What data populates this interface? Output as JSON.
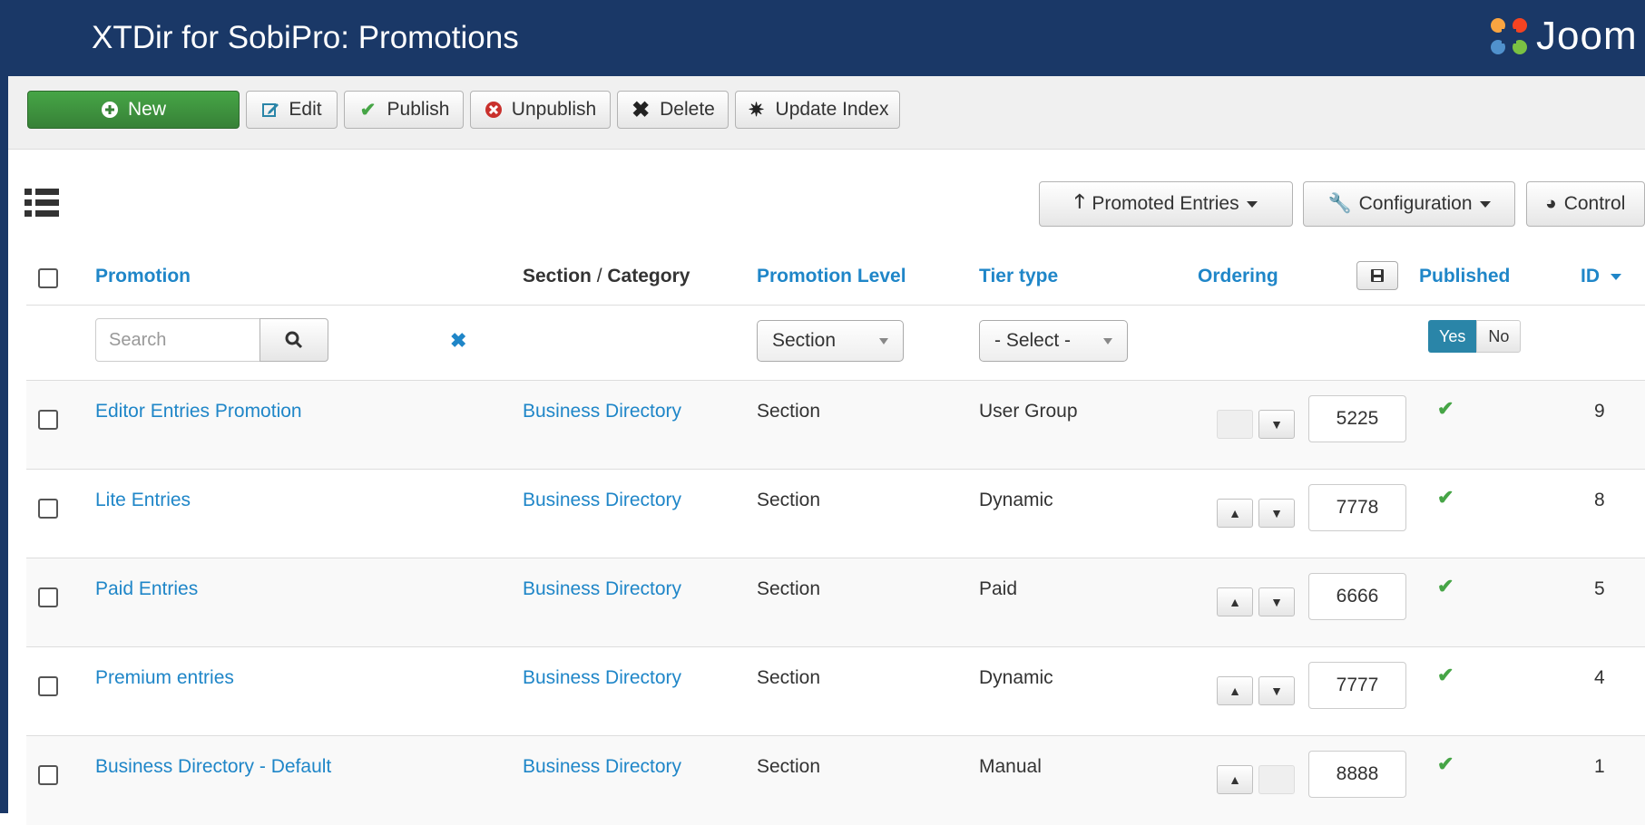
{
  "header": {
    "title": "XTDir for SobiPro: Promotions",
    "brand": "Joom"
  },
  "toolbar": {
    "new_label": "New",
    "edit_label": "Edit",
    "publish_label": "Publish",
    "unpublish_label": "Unpublish",
    "delete_label": "Delete",
    "update_index_label": "Update Index"
  },
  "menus": {
    "promoted_entries": "Promoted Entries",
    "configuration": "Configuration",
    "control": "Control"
  },
  "columns": {
    "promotion": "Promotion",
    "section": "Section",
    "slash": "/",
    "category": "Category",
    "level": "Promotion Level",
    "tier": "Tier type",
    "ordering": "Ordering",
    "published": "Published",
    "id": "ID"
  },
  "filters": {
    "search_placeholder": "Search",
    "level_value": "Section",
    "tier_value": "- Select -",
    "yes": "Yes",
    "no": "No"
  },
  "rows": [
    {
      "promotion": "Editor Entries Promotion",
      "category": "Business Directory",
      "level": "Section",
      "tier": "User Group",
      "ordering": "5225",
      "id": "9"
    },
    {
      "promotion": "Lite Entries",
      "category": "Business Directory",
      "level": "Section",
      "tier": "Dynamic",
      "ordering": "7778",
      "id": "8"
    },
    {
      "promotion": "Paid Entries",
      "category": "Business Directory",
      "level": "Section",
      "tier": "Paid",
      "ordering": "6666",
      "id": "5"
    },
    {
      "promotion": "Premium entries",
      "category": "Business Directory",
      "level": "Section",
      "tier": "Dynamic",
      "ordering": "7777",
      "id": "4"
    },
    {
      "promotion": "Business Directory - Default",
      "category": "Business Directory",
      "level": "Section",
      "tier": "Manual",
      "ordering": "8888",
      "id": "1"
    }
  ],
  "colors": {
    "header_bg": "#1a3867",
    "link": "#1f86c8",
    "new_button": "#46a546",
    "published_check": "#46a546",
    "yes_active": "#2a85a8"
  },
  "icons": [
    "plus-circle-icon",
    "edit-icon",
    "check-icon",
    "x-circle-icon",
    "x-icon",
    "gear-icon",
    "list-icon",
    "arrow-up-icon",
    "wrench-icon",
    "dashboard-icon",
    "search-icon",
    "save-icon",
    "chevron-up-icon",
    "chevron-down-icon"
  ]
}
